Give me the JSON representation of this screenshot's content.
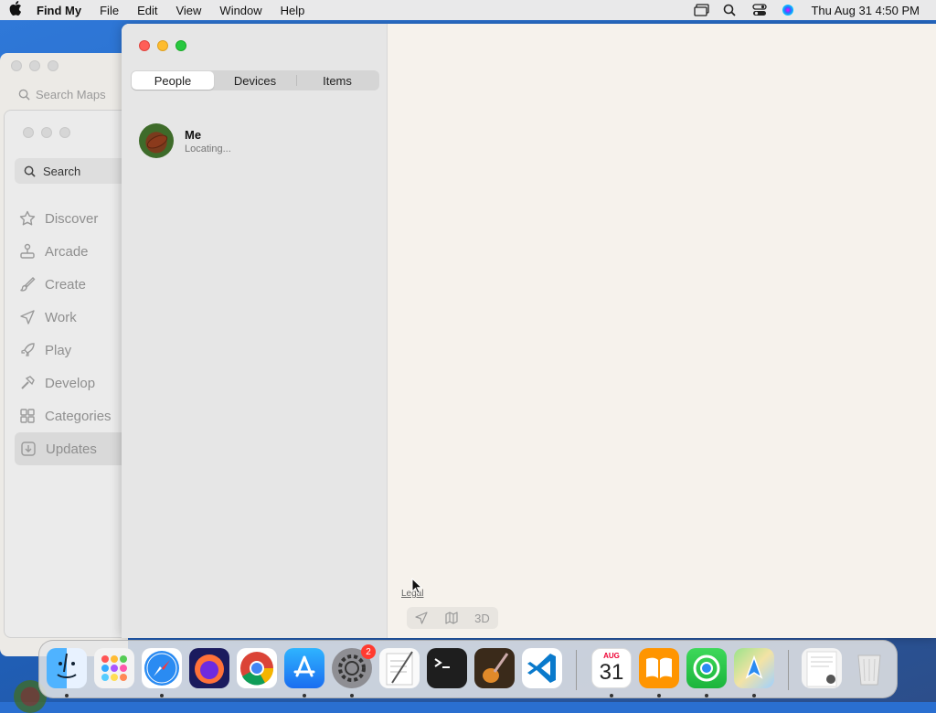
{
  "menubar": {
    "app_name": "Find My",
    "menus": [
      "File",
      "Edit",
      "View",
      "Window",
      "Help"
    ],
    "datetime": "Thu Aug 31  4:50 PM"
  },
  "maps_window": {
    "search_placeholder": "Search Maps"
  },
  "store_window": {
    "search_label": "Search",
    "nav": [
      {
        "label": "Discover",
        "icon": "star-icon"
      },
      {
        "label": "Arcade",
        "icon": "joystick-icon"
      },
      {
        "label": "Create",
        "icon": "brush-icon"
      },
      {
        "label": "Work",
        "icon": "paper-plane-icon"
      },
      {
        "label": "Play",
        "icon": "rocket-icon"
      },
      {
        "label": "Develop",
        "icon": "hammer-icon"
      },
      {
        "label": "Categories",
        "icon": "grid-icon"
      },
      {
        "label": "Updates",
        "icon": "download-icon"
      }
    ],
    "selected": "Updates"
  },
  "findmy": {
    "tabs": [
      "People",
      "Devices",
      "Items"
    ],
    "active_tab": "People",
    "people": [
      {
        "name": "Me",
        "status": "Locating..."
      }
    ],
    "legal_label": "Legal",
    "map_3d_label": "3D"
  },
  "dock": {
    "settings_badge": "2",
    "calendar_month": "AUG",
    "calendar_day": "31"
  },
  "colors": {
    "accent_red": "#ff5f57",
    "accent_yellow": "#febc2e",
    "accent_green": "#28c840"
  }
}
